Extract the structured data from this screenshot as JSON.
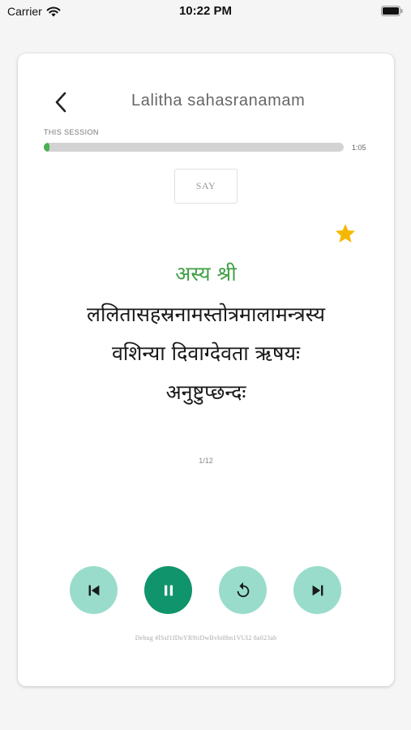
{
  "status_bar": {
    "carrier": "Carrier",
    "time": "10:22 PM"
  },
  "header": {
    "title": "Lalitha sahasranamam"
  },
  "session": {
    "label": "THIS SESSION",
    "elapsed": "1:05",
    "progress_fraction": 0.02
  },
  "say_button": {
    "label": "SAY"
  },
  "favorite": {
    "icon": "star-icon",
    "color": "#f5b800"
  },
  "verse": {
    "highlight": "अस्य श्री",
    "lines": [
      "ललितासहस्रनामस्तोत्रमालामन्त्रस्य",
      "वशिन्या   दिवाग्देवता ऋषयः",
      "अनुष्टुप्छन्दः"
    ]
  },
  "pager": {
    "text": "1/12"
  },
  "controls": {
    "previous_icon": "skip-previous-icon",
    "pause_icon": "pause-icon",
    "replay_icon": "replay-icon",
    "next_icon": "skip-next-icon"
  },
  "debug": {
    "text": "Debug #lSsf1fDoYR9iiDwBvhi8hn1VUI2 8a023ab"
  },
  "colors": {
    "accent_green": "#43a047",
    "progress_fill": "#4caf50",
    "control_light": "#99dccb",
    "control_primary": "#10946b"
  }
}
